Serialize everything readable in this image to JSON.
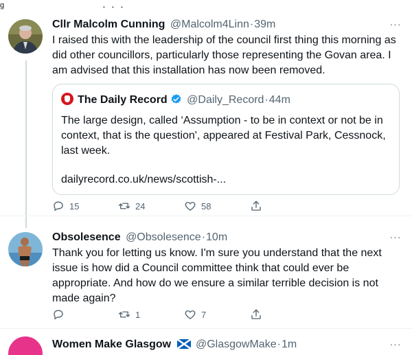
{
  "top_fragment": {
    "text": "g"
  },
  "tweets": [
    {
      "name": "Cllr Malcolm Cunning",
      "handle": "@Malcolm4Linn",
      "time": "39m",
      "text": "I raised this with the leadership of the council first thing this morning as did other councillors, particularly those representing the Govan area. I am advised that this installation has now been removed.",
      "quote": {
        "name": "The Daily Record",
        "handle": "@Daily_Record",
        "time": "44m",
        "text": "The large design, called ‘Assumption - to be in context or not be in context, that is the question', appeared at Festival Park, Cessnock, last week.",
        "link": "dailyrecord.co.uk/news/scottish-..."
      },
      "replies": "15",
      "retweets": "24",
      "likes": "58"
    },
    {
      "name": "Obsolesence",
      "handle": "@Obsolesence",
      "time": "10m",
      "text": "Thank you for letting us know. I'm sure you understand that the next issue is how did a Council committee think that could ever be appropriate. And how do we ensure a similar terrible decision is not made again?",
      "replies": "",
      "retweets": "1",
      "likes": "7"
    },
    {
      "name": "Women Make Glasgow",
      "flag": "🏴",
      "handle": "@GlasgowMake",
      "time": "1m"
    }
  ],
  "separator": "·",
  "colors": {
    "text": "#0f1419",
    "muted": "#536471",
    "border": "#cfd9de",
    "verified": "#1d9bf0",
    "brand_red": "#d4171e",
    "pink": "#e8338a"
  },
  "icons": [
    "reply-icon",
    "retweet-icon",
    "like-icon",
    "share-icon",
    "more-icon",
    "verified-icon",
    "saltire-flag-icon"
  ]
}
